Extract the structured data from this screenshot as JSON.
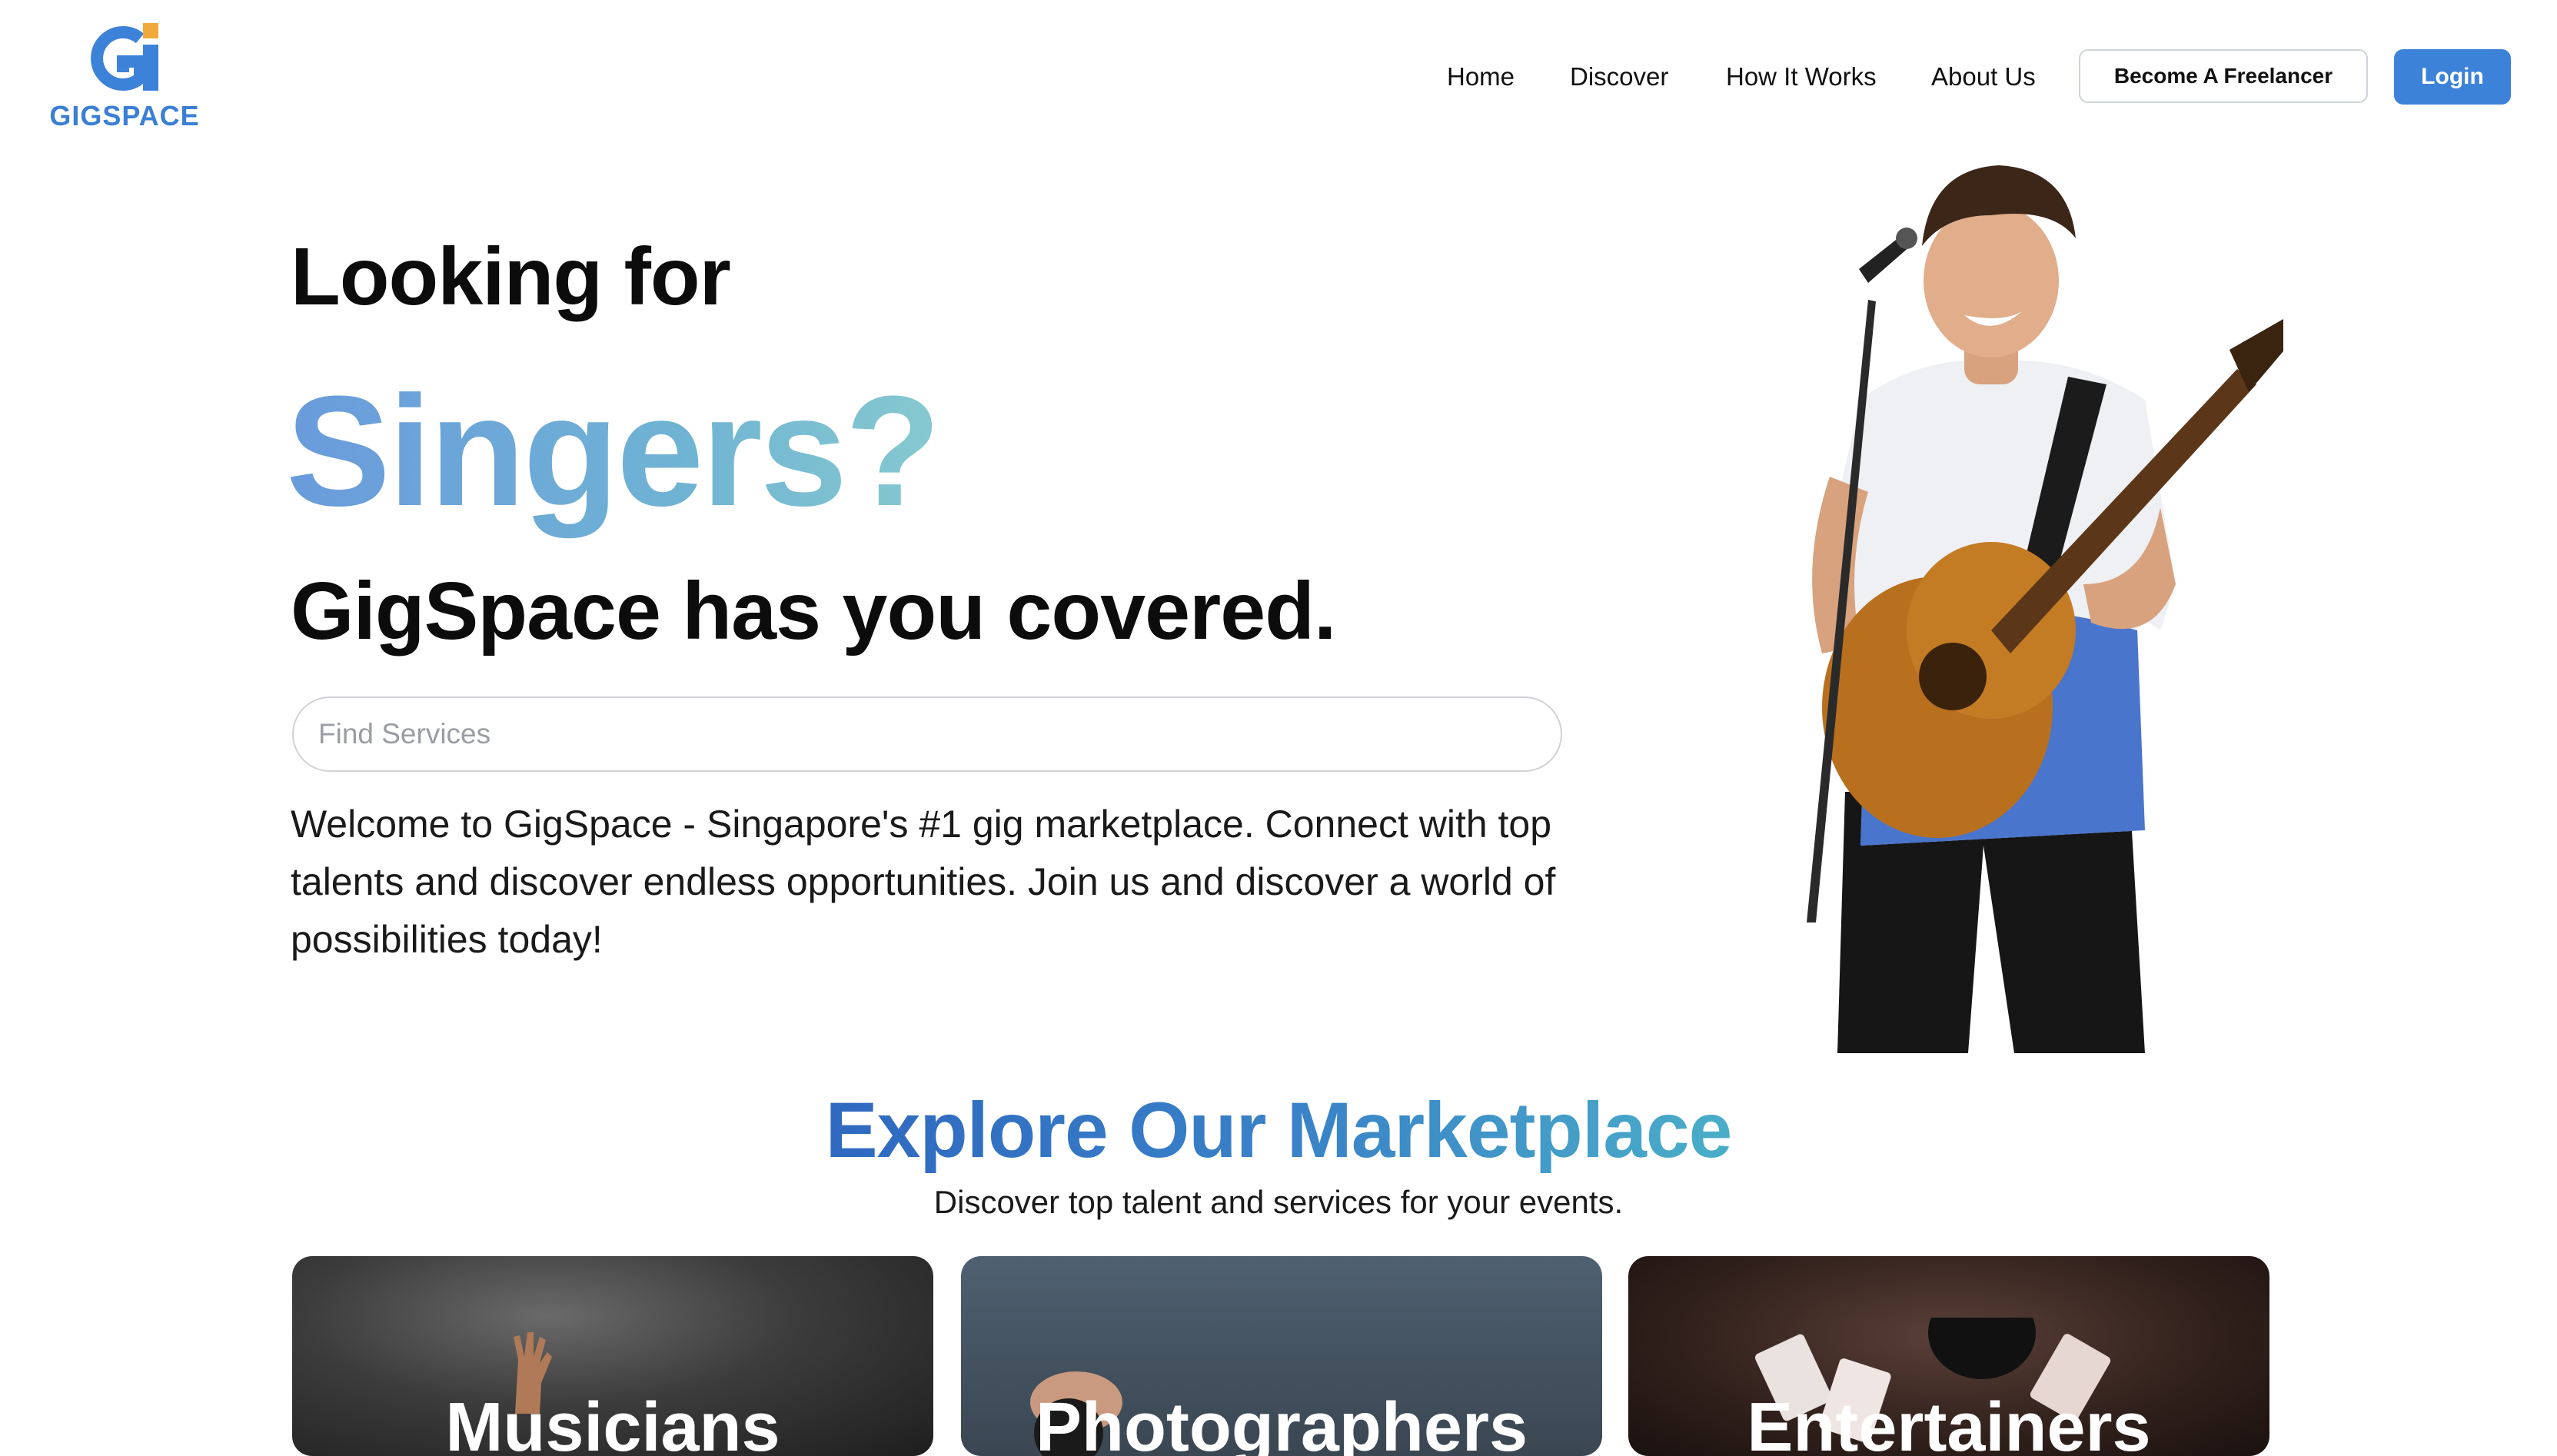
{
  "brand": {
    "name": "GIGSPACE",
    "colors": {
      "primary": "#3d82d9",
      "accent": "#f2a93b",
      "text": "#111111"
    }
  },
  "nav": {
    "links": [
      "Home",
      "Discover",
      "How It Works",
      "About Us"
    ],
    "become_freelancer": "Become A Freelancer",
    "login": "Login"
  },
  "hero": {
    "looking_for": "Looking for",
    "highlight": "Singers?",
    "covered": "GigSpace has you covered.",
    "search_placeholder": "Find Services",
    "welcome": "Welcome to GigSpace - Singapore's #1 gig marketplace. Connect with top talents and discover endless opportunities. Join us and discover a world of possibilities today!"
  },
  "explore": {
    "title": "Explore Our Marketplace",
    "subtitle": "Discover top talent and services for your events."
  },
  "categories": [
    {
      "label": "Musicians",
      "icon": "musician-image"
    },
    {
      "label": "Photographers",
      "icon": "photographer-image"
    },
    {
      "label": "Entertainers",
      "icon": "entertainer-image"
    }
  ]
}
